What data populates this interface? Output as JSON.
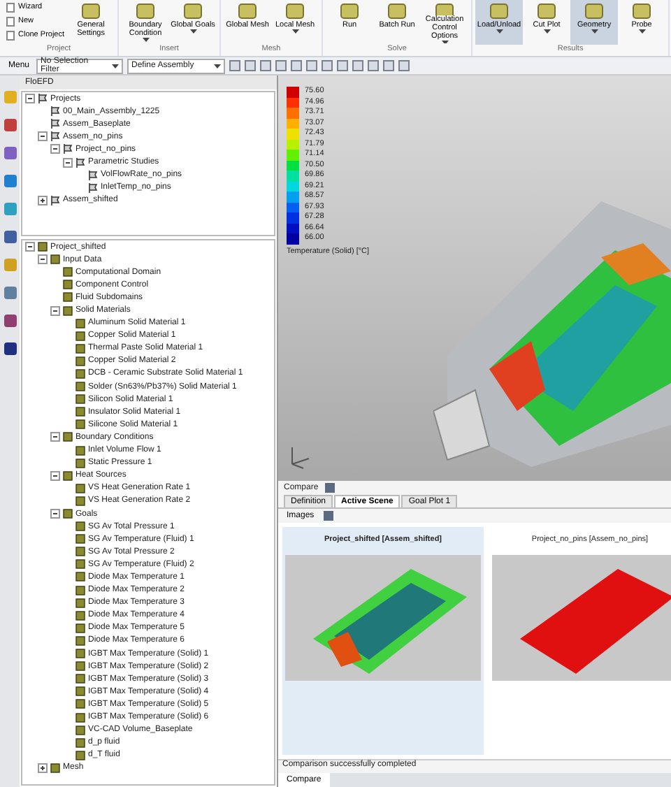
{
  "ribbon": {
    "groups": [
      {
        "label": "Project",
        "buttons": [
          {
            "label": "Wizard",
            "kind": "small",
            "selected": false
          },
          {
            "label": "New",
            "kind": "small",
            "selected": false
          },
          {
            "label": "Clone Project",
            "kind": "small",
            "selected": false
          },
          {
            "label": "General Settings",
            "kind": "large",
            "menu": false,
            "selected": false
          }
        ]
      },
      {
        "label": "Insert",
        "buttons": [
          {
            "label": "Boundary Condition",
            "kind": "large",
            "menu": true,
            "selected": false
          },
          {
            "label": "Global Goals",
            "kind": "large",
            "menu": true,
            "selected": false
          }
        ]
      },
      {
        "label": "Mesh",
        "buttons": [
          {
            "label": "Global Mesh",
            "kind": "large",
            "menu": false,
            "selected": false
          },
          {
            "label": "Local Mesh",
            "kind": "large",
            "menu": true,
            "selected": false
          }
        ]
      },
      {
        "label": "Solve",
        "buttons": [
          {
            "label": "Run",
            "kind": "large",
            "menu": false,
            "selected": false
          },
          {
            "label": "Batch Run",
            "kind": "large",
            "menu": false,
            "selected": false
          },
          {
            "label": "Calculation Control Options",
            "kind": "large",
            "menu": true,
            "selected": false
          }
        ]
      },
      {
        "label": "Results",
        "buttons": [
          {
            "label": "Load/Unload",
            "kind": "large",
            "menu": true,
            "selected": true
          },
          {
            "label": "Cut Plot",
            "kind": "large",
            "menu": true,
            "selected": false
          },
          {
            "label": "Geometry",
            "kind": "large",
            "menu": true,
            "selected": true
          },
          {
            "label": "Probe",
            "kind": "large",
            "menu": true,
            "selected": false
          }
        ]
      }
    ]
  },
  "toolbar": {
    "menu": "Menu",
    "selection_filter": "No Selection Filter",
    "assembly": "Define Assembly"
  },
  "panel_title": "FloEFD",
  "projects_tree": [
    {
      "label": "Projects",
      "expanded": true,
      "children": [
        {
          "label": "00_Main_Assembly_1225"
        },
        {
          "label": "Assem_Baseplate"
        },
        {
          "label": "Assem_no_pins",
          "expanded": true,
          "children": [
            {
              "label": "Project_no_pins",
              "expanded": true,
              "children": [
                {
                  "label": "Parametric Studies",
                  "expanded": true,
                  "children": [
                    {
                      "label": "VolFlowRate_no_pins"
                    },
                    {
                      "label": "InletTemp_no_pins"
                    }
                  ]
                }
              ]
            }
          ]
        },
        {
          "label": "Assem_shifted",
          "expanded": false
        }
      ]
    }
  ],
  "analysis_tree": [
    {
      "label": "Project_shifted",
      "expanded": true,
      "children": [
        {
          "label": "Input Data",
          "expanded": true,
          "children": [
            {
              "label": "Computational Domain"
            },
            {
              "label": "Component Control"
            },
            {
              "label": "Fluid Subdomains"
            },
            {
              "label": "Solid Materials",
              "expanded": true,
              "children": [
                {
                  "label": "Aluminum Solid Material 1"
                },
                {
                  "label": "Copper Solid Material 1"
                },
                {
                  "label": "Thermal Paste Solid Material 1"
                },
                {
                  "label": "Copper Solid Material 2"
                },
                {
                  "label": "DCB - Ceramic Substrate Solid Material 1"
                },
                {
                  "label": "Solder (Sn63%/Pb37%) Solid Material 1"
                },
                {
                  "label": "Silicon Solid Material 1"
                },
                {
                  "label": "Insulator Solid Material 1"
                },
                {
                  "label": "Silicone Solid Material 1"
                }
              ]
            },
            {
              "label": "Boundary Conditions",
              "expanded": true,
              "children": [
                {
                  "label": "Inlet Volume Flow 1"
                },
                {
                  "label": "Static Pressure 1"
                }
              ]
            },
            {
              "label": "Heat Sources",
              "expanded": true,
              "children": [
                {
                  "label": "VS Heat Generation Rate 1"
                },
                {
                  "label": "VS Heat Generation Rate 2"
                }
              ]
            },
            {
              "label": "Goals",
              "expanded": true,
              "children": [
                {
                  "label": "SG Av Total Pressure 1"
                },
                {
                  "label": "SG Av Temperature (Fluid) 1"
                },
                {
                  "label": "SG Av Total Pressure 2"
                },
                {
                  "label": "SG Av Temperature (Fluid) 2"
                },
                {
                  "label": "Diode Max Temperature 1"
                },
                {
                  "label": "Diode Max Temperature 2"
                },
                {
                  "label": "Diode Max Temperature 3"
                },
                {
                  "label": "Diode Max Temperature 4"
                },
                {
                  "label": "Diode Max Temperature 5"
                },
                {
                  "label": "Diode Max Temperature 6"
                },
                {
                  "label": "IGBT Max Temperature (Solid) 1"
                },
                {
                  "label": "IGBT Max Temperature (Solid) 2"
                },
                {
                  "label": "IGBT Max Temperature (Solid) 3"
                },
                {
                  "label": "IGBT Max Temperature (Solid) 4"
                },
                {
                  "label": "IGBT Max Temperature (Solid) 5"
                },
                {
                  "label": "IGBT Max Temperature (Solid) 6"
                },
                {
                  "label": "VC-CAD Volume_Baseplate"
                },
                {
                  "label": "d_p fluid"
                },
                {
                  "label": "d_T fluid"
                }
              ]
            }
          ]
        },
        {
          "label": "Mesh",
          "expanded": false
        }
      ]
    }
  ],
  "legend": {
    "values": [
      "75.60",
      "74.96",
      "73.71",
      "73.07",
      "72.43",
      "71.79",
      "71.14",
      "70.50",
      "69.86",
      "69.21",
      "68.57",
      "67.93",
      "67.28",
      "66.64",
      "66.00"
    ],
    "title": "Temperature (Solid) [°C]"
  },
  "compare_panel": {
    "toolbar": "Compare",
    "tabs": [
      {
        "label": "Definition",
        "selected": false
      },
      {
        "label": "Active Scene",
        "selected": true
      },
      {
        "label": "Goal Plot 1",
        "selected": false
      }
    ],
    "images_menu": "Images",
    "cards": [
      {
        "title": "Project_shifted [Assem_shifted]",
        "selected": true,
        "kind": "gradient"
      },
      {
        "title": "Project_no_pins [Assem_no_pins]",
        "selected": false,
        "kind": "hot"
      }
    ],
    "status": "Comparison successfully completed",
    "bottom_tab": "Compare"
  }
}
